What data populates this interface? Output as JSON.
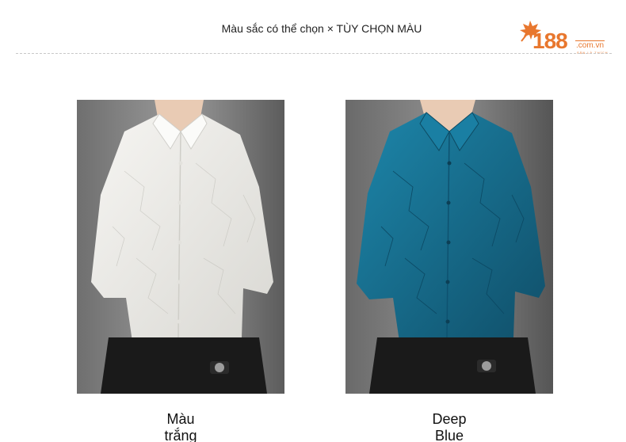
{
  "header": {
    "title": "Màu sắc có thể chọn × TÙY CHỌN MÀU"
  },
  "logo": {
    "number": "188",
    "domain": ".com.vn",
    "slogan": "SĂN LÀ THÍCH",
    "icon": "maple-leaf-icon",
    "brand_color": "#e8772e"
  },
  "products": [
    {
      "label_line1": "Màu",
      "label_line2": "trắng",
      "image": "white-jacquard-shirt",
      "shirt_color": "#ecebe7"
    },
    {
      "label_line1": "Deep",
      "label_line2": "Blue",
      "image": "deep-blue-jacquard-shirt",
      "shirt_color": "#1b6f8f"
    }
  ]
}
